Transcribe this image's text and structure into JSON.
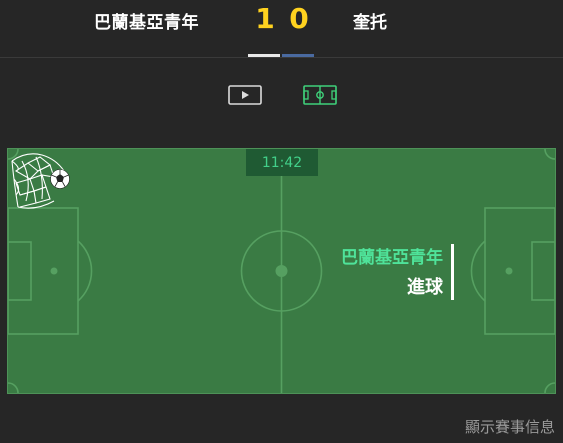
{
  "match": {
    "home_team": "巴蘭基亞青年",
    "away_team": "奎托",
    "home_score": "1",
    "away_score": "0",
    "home_bar_color": "#e9e9e9",
    "away_bar_color": "#4a6aa0",
    "score_color": "#ffd21f"
  },
  "view_toggles": [
    {
      "icon": "play-video-icon",
      "active": false
    },
    {
      "icon": "pitch-field-icon",
      "active": true
    }
  ],
  "pitch": {
    "clock": "11:42",
    "event": {
      "team": "巴蘭基亞青年",
      "type": "進球",
      "icon": "goal-net-ball-icon"
    },
    "colors": {
      "grass": "#3a7b44",
      "lines": "#56a061",
      "clock_bg": "#1f5a33",
      "clock_text": "#42d08a",
      "event_team_text": "#4fe39a"
    }
  },
  "footer": {
    "info_link": "顯示賽事信息"
  }
}
